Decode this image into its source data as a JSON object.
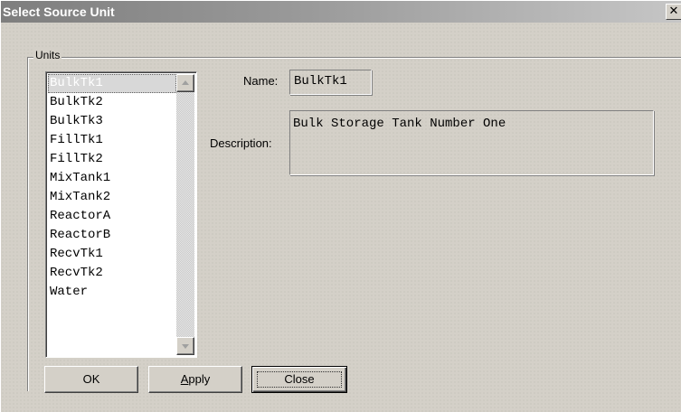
{
  "window": {
    "title": "Select Source Unit",
    "close_glyph": "✕"
  },
  "units_group": {
    "label": "Units",
    "items": [
      {
        "label": "BulkTk1",
        "selected": true
      },
      {
        "label": "BulkTk2"
      },
      {
        "label": "BulkTk3"
      },
      {
        "label": "FillTk1"
      },
      {
        "label": "FillTk2"
      },
      {
        "label": "MixTank1"
      },
      {
        "label": "MixTank2"
      },
      {
        "label": "ReactorA"
      },
      {
        "label": "ReactorB"
      },
      {
        "label": "RecvTk1"
      },
      {
        "label": "RecvTk2"
      },
      {
        "label": "Water"
      }
    ],
    "scroll_up_icon": "arrow-up-icon",
    "scroll_down_icon": "arrow-down-icon"
  },
  "details": {
    "name_label": "Name:",
    "name_value": "BulkTk1",
    "description_label": "Description:",
    "description_value": "Bulk Storage Tank Number One"
  },
  "buttons": {
    "ok_label": "OK",
    "apply_label_first": "A",
    "apply_label_rest": "pply",
    "close_label": "Close"
  }
}
